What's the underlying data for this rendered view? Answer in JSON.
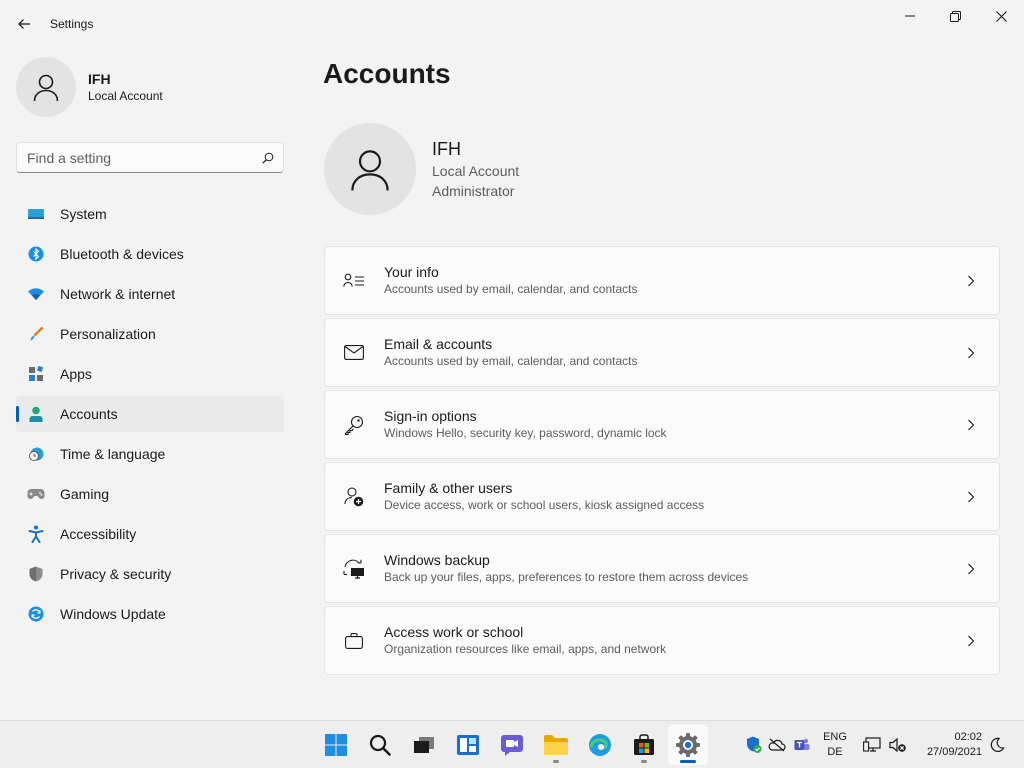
{
  "window": {
    "title": "Settings"
  },
  "profile": {
    "name": "IFH",
    "account_type": "Local Account"
  },
  "search": {
    "placeholder": "Find a setting"
  },
  "nav": {
    "items": [
      {
        "label": "System",
        "icon": "monitor-icon"
      },
      {
        "label": "Bluetooth & devices",
        "icon": "bluetooth-icon"
      },
      {
        "label": "Network & internet",
        "icon": "wifi-icon"
      },
      {
        "label": "Personalization",
        "icon": "brush-icon"
      },
      {
        "label": "Apps",
        "icon": "apps-icon"
      },
      {
        "label": "Accounts",
        "icon": "person-icon",
        "selected": true
      },
      {
        "label": "Time & language",
        "icon": "globe-clock-icon"
      },
      {
        "label": "Gaming",
        "icon": "gamepad-icon"
      },
      {
        "label": "Accessibility",
        "icon": "accessibility-icon"
      },
      {
        "label": "Privacy & security",
        "icon": "shield-icon"
      },
      {
        "label": "Windows Update",
        "icon": "update-icon"
      }
    ]
  },
  "main": {
    "title": "Accounts",
    "account": {
      "name": "IFH",
      "type": "Local Account",
      "role": "Administrator"
    },
    "cards": [
      {
        "title": "Your info",
        "subtitle": "Accounts used by email, calendar, and contacts",
        "icon": "person-list-icon"
      },
      {
        "title": "Email & accounts",
        "subtitle": "Accounts used by email, calendar, and contacts",
        "icon": "mail-icon"
      },
      {
        "title": "Sign-in options",
        "subtitle": "Windows Hello, security key, password, dynamic lock",
        "icon": "key-icon"
      },
      {
        "title": "Family & other users",
        "subtitle": "Device access, work or school users, kiosk assigned access",
        "icon": "person-add-icon"
      },
      {
        "title": "Windows backup",
        "subtitle": "Back up your files, apps, preferences to restore them across devices",
        "icon": "backup-icon"
      },
      {
        "title": "Access work or school",
        "subtitle": "Organization resources like email, apps, and network",
        "icon": "briefcase-icon"
      }
    ]
  },
  "taskbar": {
    "apps": [
      "start-icon",
      "search-icon",
      "task-view-icon",
      "widgets-icon",
      "chat-icon",
      "file-explorer-icon",
      "edge-icon",
      "store-icon",
      "settings-icon"
    ],
    "tray": {
      "lang_line1": "ENG",
      "lang_line2": "DE",
      "time": "02:02",
      "date": "27/09/2021"
    }
  },
  "colors": {
    "accent": "#005fb8",
    "background": "#f3f3f3",
    "card": "#fbfbfb"
  }
}
